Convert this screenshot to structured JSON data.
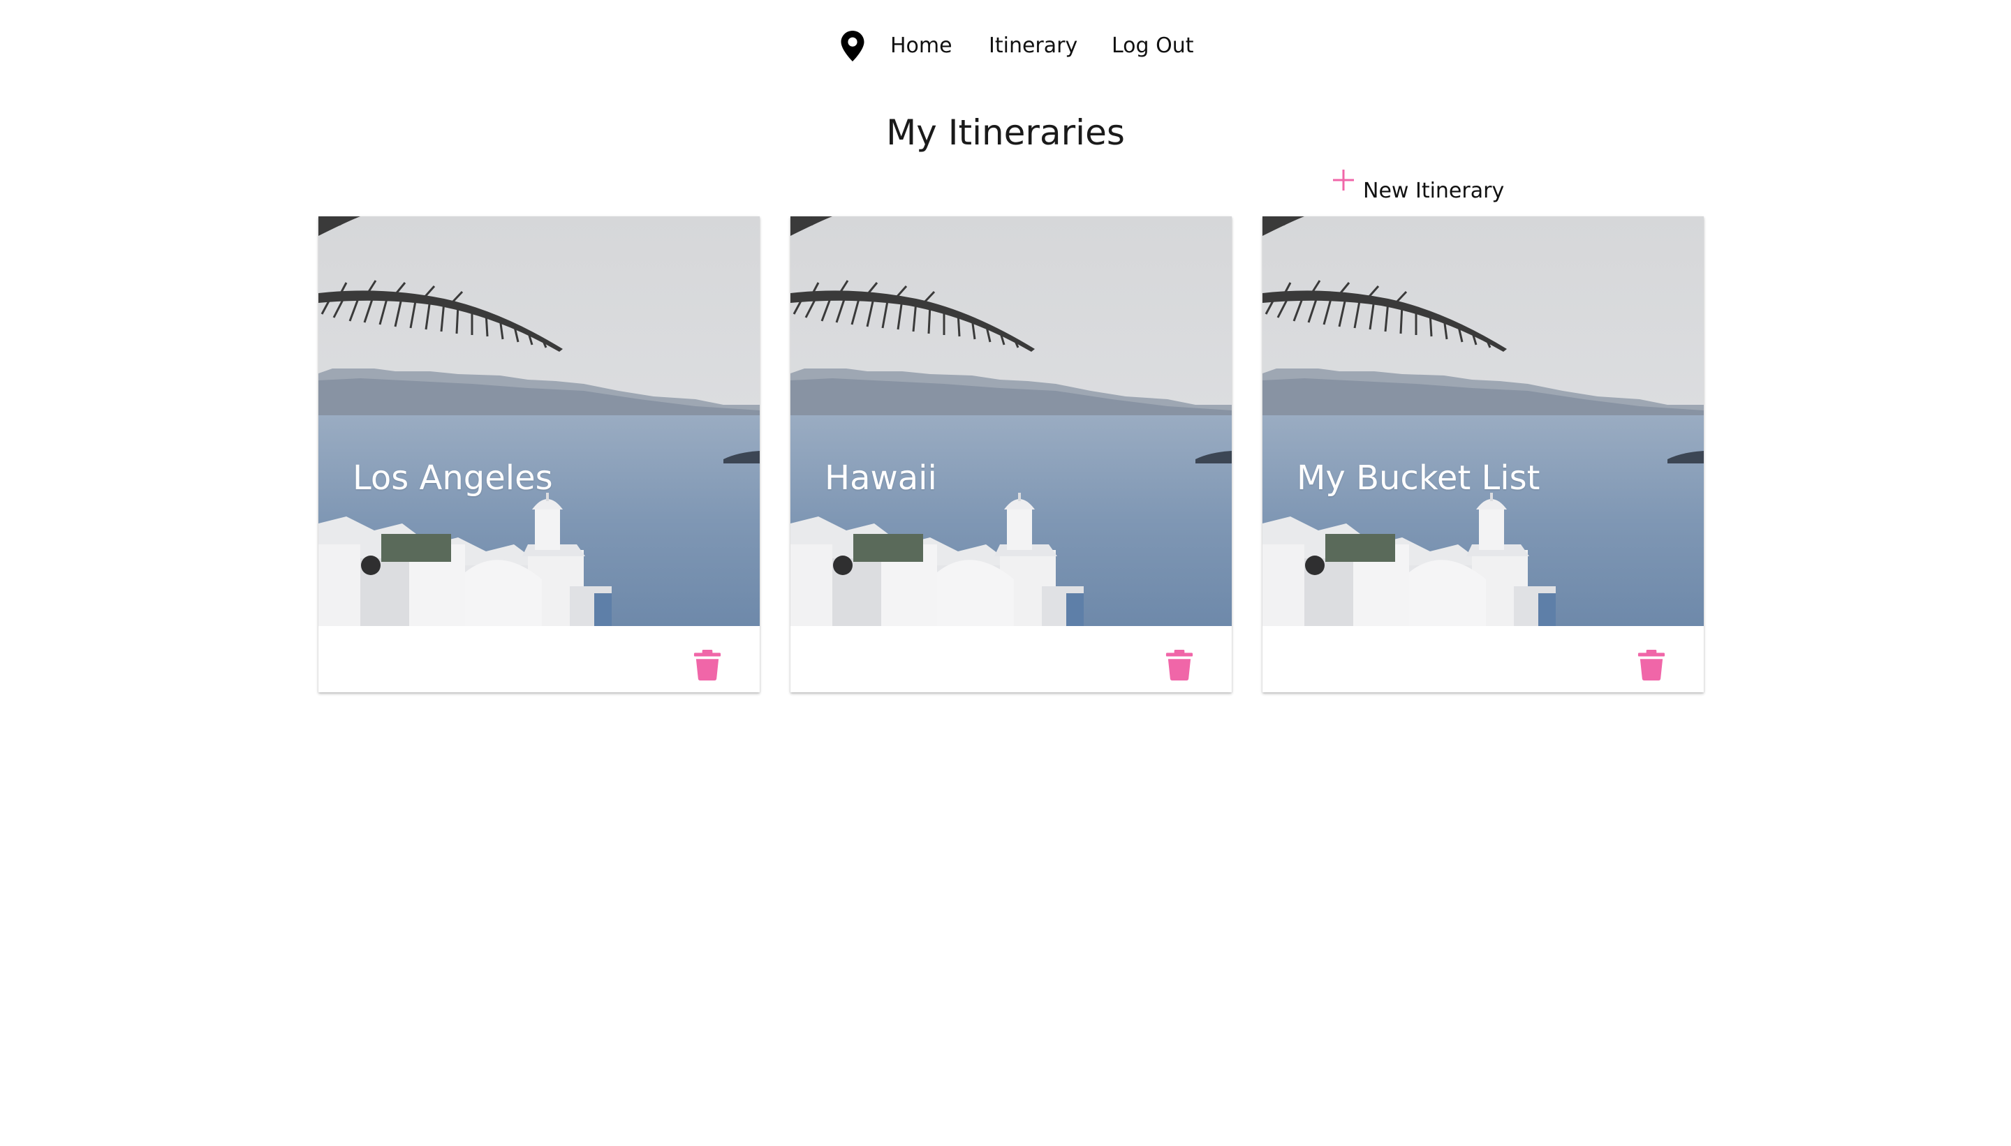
{
  "nav": {
    "brand_icon": "map-marker-icon",
    "links": [
      {
        "label": "Home"
      },
      {
        "label": "Itinerary"
      },
      {
        "label": "Log Out"
      }
    ]
  },
  "page": {
    "title": "My Itineraries"
  },
  "actions": {
    "new_itinerary_icon": "plus-icon",
    "new_itinerary_label": "New Itinerary"
  },
  "cards": [
    {
      "title": "Los Angeles",
      "delete_icon": "trash-icon"
    },
    {
      "title": "Hawaii",
      "delete_icon": "trash-icon"
    },
    {
      "title": "My Bucket List",
      "delete_icon": "trash-icon"
    }
  ],
  "colors": {
    "accent": "#f066a8",
    "text": "#1a1a1a",
    "card_title": "#ffffff"
  }
}
